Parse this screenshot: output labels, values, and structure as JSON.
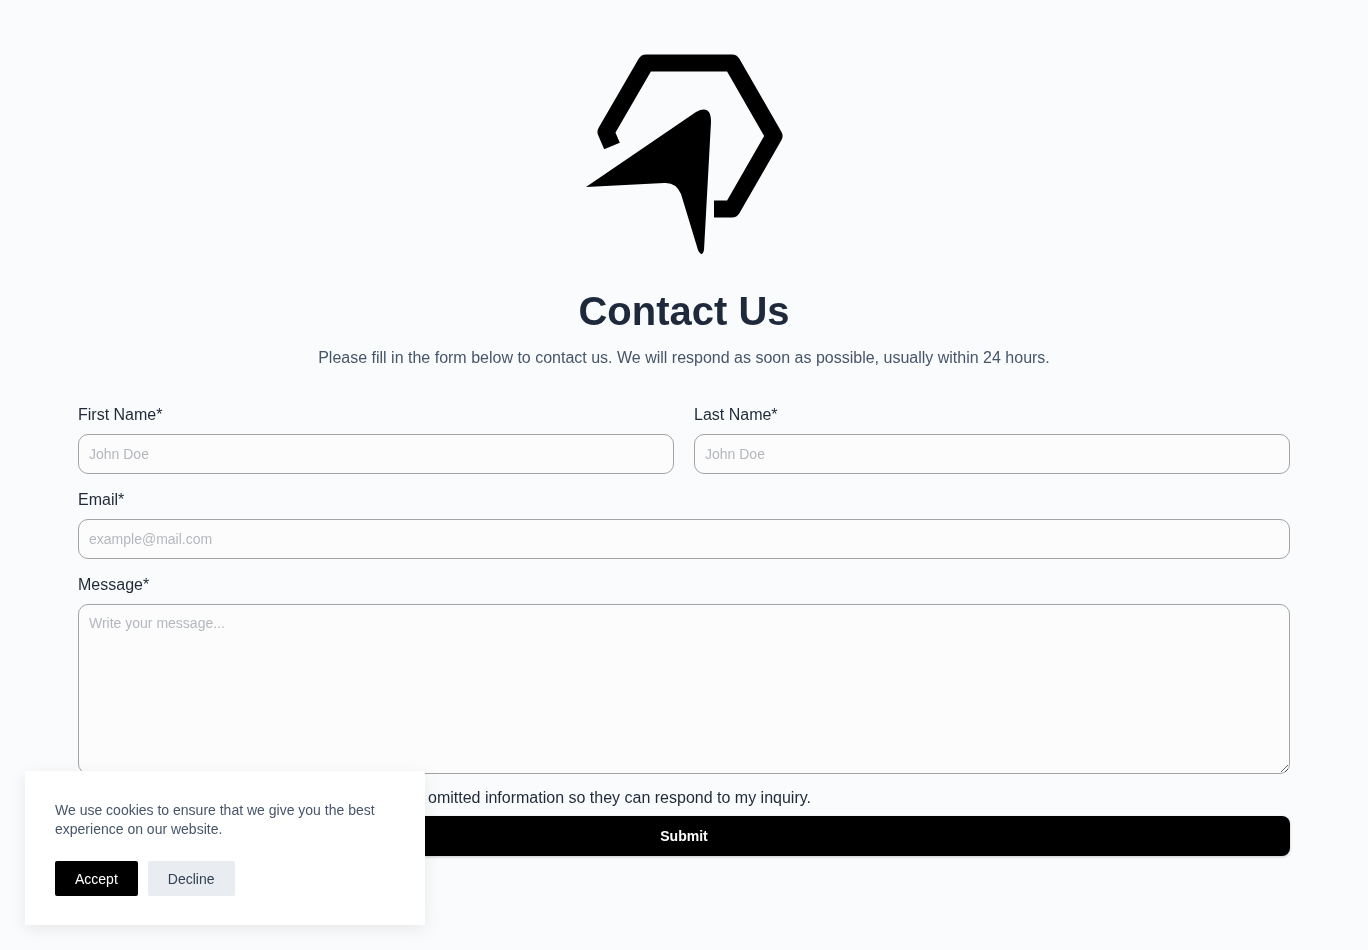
{
  "title": "Contact Us",
  "subtitle": "Please fill in the form below to contact us. We will respond as soon as possible, usually within 24 hours.",
  "form_rows": [
    [
      {
        "label": "First Name*",
        "placeholder": "John Doe",
        "kind": "input"
      },
      {
        "label": "Last Name*",
        "placeholder": "John Doe",
        "kind": "input"
      }
    ],
    [
      {
        "label": "Email*",
        "placeholder": "example@mail.com",
        "kind": "input"
      }
    ],
    [
      {
        "label": "Message*",
        "placeholder": "Write your message...",
        "kind": "textarea"
      }
    ]
  ],
  "consent_text": "omitted information so they can respond to my inquiry.",
  "submit": "Submit",
  "cookie_banner": {
    "text": "We use cookies to ensure that we give you the best experience on our website.",
    "buttons": [
      {
        "label": "Accept",
        "kind": "primary"
      },
      {
        "label": "Decline",
        "kind": "secondary"
      }
    ]
  }
}
